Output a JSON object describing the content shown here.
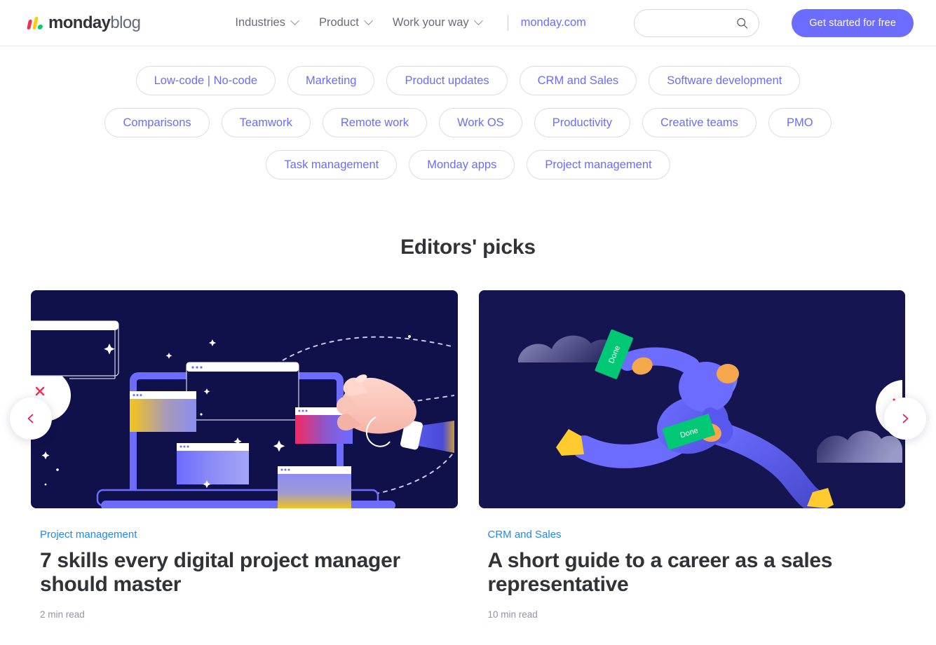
{
  "header": {
    "logo": {
      "bold": "monday",
      "light": "blog"
    },
    "nav": [
      {
        "label": "Industries",
        "has_chevron": true
      },
      {
        "label": "Product",
        "has_chevron": true
      },
      {
        "label": "Work your way",
        "has_chevron": true
      }
    ],
    "site_link": "monday.com",
    "search": {
      "value": "",
      "placeholder": "",
      "icon": "search-icon"
    },
    "cta": "Get started for free"
  },
  "tags": {
    "row1": [
      "Low-code | No-code",
      "Marketing",
      "Product updates",
      "CRM and Sales",
      "Software development"
    ],
    "row2": [
      "Comparisons",
      "Teamwork",
      "Remote work",
      "Work OS",
      "Productivity",
      "Creative teams",
      "PMO"
    ],
    "row3": [
      "Task management",
      "Monday apps",
      "Project management"
    ]
  },
  "editors_picks": {
    "title": "Editors' picks",
    "prev_label": "Previous",
    "next_label": "Next",
    "cards": [
      {
        "category": "Project management",
        "title": "7 skills every digital project manager should master",
        "read_time": "2 min read",
        "illustration": "laptop-browser-windows-hand"
      },
      {
        "category": "CRM and Sales",
        "title": "A short guide to a career as a sales representative",
        "read_time": "10 min read",
        "illustration": "running-person-done-labels",
        "label_text": "Done"
      }
    ]
  },
  "colors": {
    "brand_purple": "#6c6cff",
    "link_blue": "#1f88f2",
    "accent_pink": "#f62b54",
    "accent_yellow": "#ffcb00",
    "accent_green": "#00ca72",
    "dark_navy": "#10104a",
    "text_dark": "#323338",
    "text_muted": "#9293a5"
  }
}
